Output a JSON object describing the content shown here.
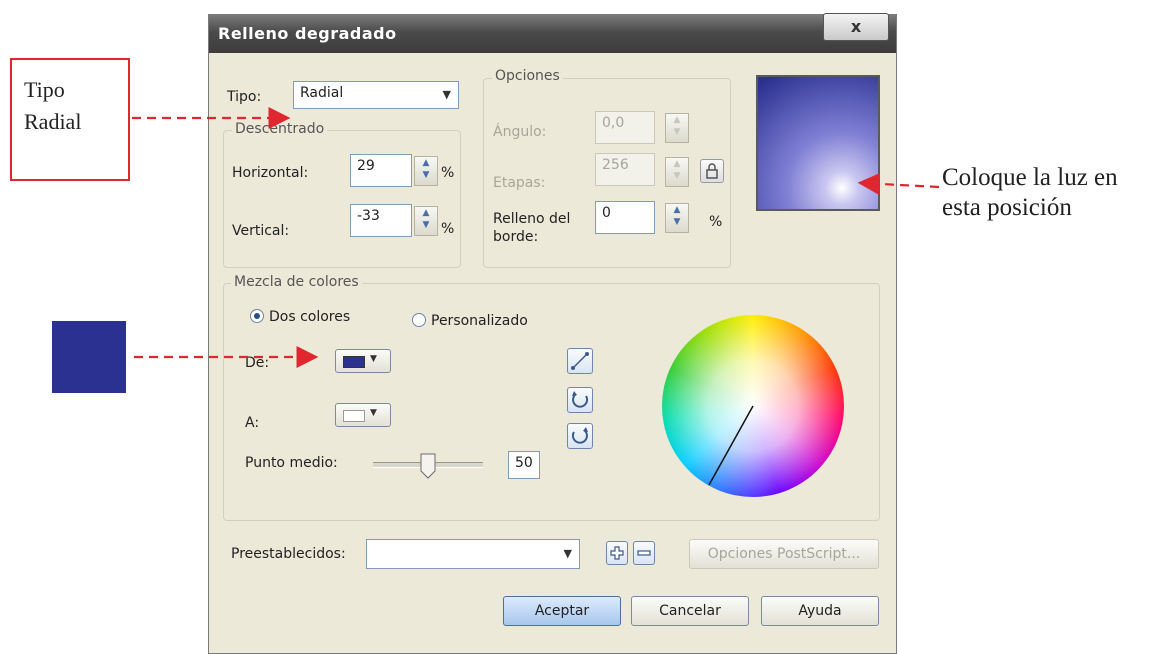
{
  "window": {
    "title": "Relleno degradado",
    "close_label": "x"
  },
  "annotations": {
    "tipo_line1": "Tipo",
    "tipo_line2": "Radial",
    "luz_line1": "Coloque la luz en",
    "luz_line2": "esta posición",
    "swatch_color": "#2b3190",
    "arrow_color": "#e0262e"
  },
  "tipo": {
    "label": "Tipo:",
    "value": "Radial"
  },
  "descentrado": {
    "title": "Descentrado",
    "horizontal_label": "Horizontal:",
    "horizontal_value": "29",
    "vertical_label": "Vertical:",
    "vertical_value": "-33",
    "unit": "%"
  },
  "opciones": {
    "title": "Opciones",
    "angulo_label": "Ángulo:",
    "angulo_value": "0,0",
    "etapas_label": "Etapas:",
    "etapas_value": "256",
    "relleno_label_line1": "Relleno del",
    "relleno_label_line2": "borde:",
    "relleno_value": "0",
    "unit": "%"
  },
  "mezcla": {
    "title": "Mezcla de colores",
    "option_dos": "Dos colores",
    "option_personalizado": "Personalizado",
    "de_label": "De:",
    "de_color": "#2b3190",
    "a_label": "A:",
    "a_color": "#ffffff",
    "punto_medio_label": "Punto medio:",
    "punto_medio_value": "50",
    "punto_medio_fraction": 0.5
  },
  "preestablecidos": {
    "label": "Preestablecidos:",
    "value": ""
  },
  "buttons": {
    "postscript": "Opciones PostScript...",
    "aceptar": "Aceptar",
    "cancelar": "Cancelar",
    "ayuda": "Ayuda"
  },
  "colors": {
    "preview_dark": "#2b3190",
    "preview_light": "#ffffff",
    "dialog_bg": "#ece9d8",
    "accent": "#e0262e"
  }
}
